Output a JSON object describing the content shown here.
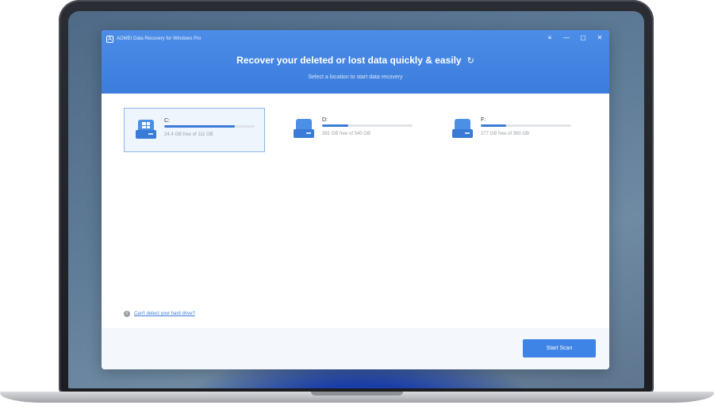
{
  "app": {
    "title": "AOMEI Data Recovery for Windows Pro",
    "logo_letter": "A",
    "window_controls": [
      {
        "name": "menu-icon",
        "glyph": "≡"
      },
      {
        "name": "minimize-icon",
        "glyph": "—"
      },
      {
        "name": "maximize-icon",
        "glyph": "▢"
      },
      {
        "name": "close-icon",
        "glyph": "✕"
      }
    ]
  },
  "header": {
    "headline": "Recover your deleted or lost data quickly & easily",
    "refresh_icon": "refresh-icon",
    "refresh_glyph": "↻",
    "subtitle": "Select a location to start data recovery"
  },
  "drives": [
    {
      "letter": "C:",
      "free_text": "24.4 GB free of 111 GB",
      "used_fraction": 0.78,
      "selected": true,
      "system": true
    },
    {
      "letter": "D:",
      "free_text": "381 GB free of 540 GB",
      "used_fraction": 0.29,
      "selected": false,
      "system": false
    },
    {
      "letter": "F:",
      "free_text": "277 GB free of 390 GB",
      "used_fraction": 0.28,
      "selected": false,
      "system": false
    }
  ],
  "help": {
    "info_glyph": "i",
    "link_text": "Can't detect your hard drive?"
  },
  "footer": {
    "start_label": "Start Scan"
  },
  "colors": {
    "accent": "#3a7bd8",
    "header_blue": "#4c8de8",
    "selected_border": "#8bb6ec"
  }
}
